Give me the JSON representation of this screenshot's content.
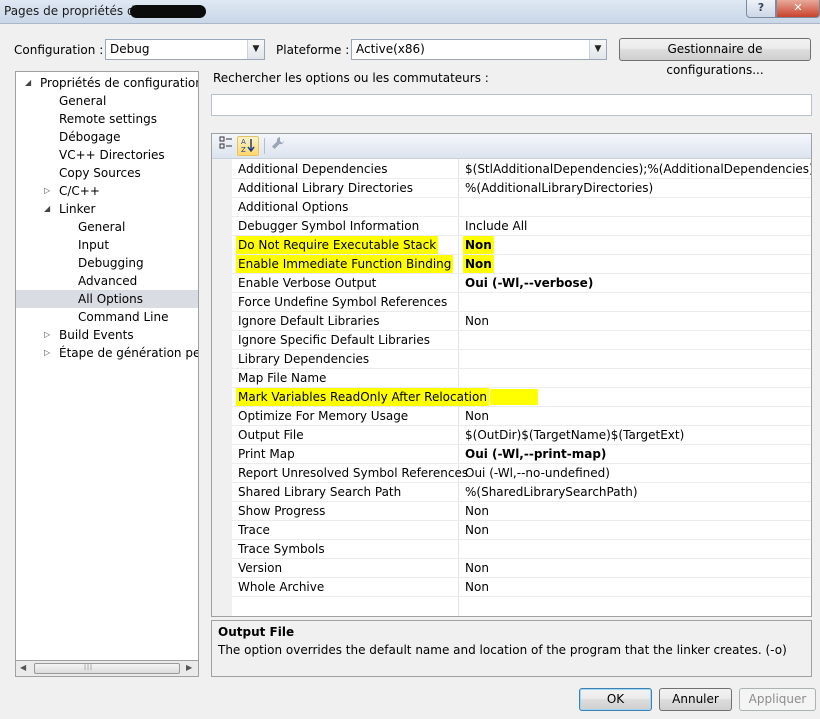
{
  "window": {
    "title": "Pages de propriétés de",
    "help_label": "?",
    "close_label": "✕"
  },
  "config": {
    "configuration_label": "Configuration :",
    "configuration_value": "Debug",
    "platform_label": "Plateforme :",
    "platform_value": "Active(x86)",
    "manager_button": "Gestionnaire de configurations..."
  },
  "tree": {
    "items": [
      {
        "label": "Propriétés de configuration",
        "expander": "◢"
      },
      {
        "label": "General"
      },
      {
        "label": "Remote settings"
      },
      {
        "label": "Débogage"
      },
      {
        "label": "VC++ Directories"
      },
      {
        "label": "Copy Sources"
      },
      {
        "label": "C/C++",
        "expander": "▷"
      },
      {
        "label": "Linker",
        "expander": "◢"
      },
      {
        "label": "General"
      },
      {
        "label": "Input"
      },
      {
        "label": "Debugging"
      },
      {
        "label": "Advanced"
      },
      {
        "label": "All Options"
      },
      {
        "label": "Command Line"
      },
      {
        "label": "Build Events",
        "expander": "▷"
      },
      {
        "label": "Étape de génération perso",
        "expander": "▷"
      }
    ],
    "selected": "All Options"
  },
  "search": {
    "label": "Rechercher les options ou les commutateurs :",
    "value": ""
  },
  "grid": {
    "rows": [
      {
        "name": "Additional Dependencies",
        "value": "$(StlAdditionalDependencies);%(AdditionalDependencies)"
      },
      {
        "name": "Additional Library Directories",
        "value": "%(AdditionalLibraryDirectories)"
      },
      {
        "name": "Additional Options",
        "value": ""
      },
      {
        "name": "Debugger Symbol Information",
        "value": "Include All"
      },
      {
        "name": "Do Not Require Executable Stack",
        "value": "Non"
      },
      {
        "name": "Enable Immediate Function Binding",
        "value": "Non"
      },
      {
        "name": "Enable Verbose Output",
        "value": "Oui (-Wl,--verbose)"
      },
      {
        "name": "Force Undefine Symbol References",
        "value": ""
      },
      {
        "name": "Ignore Default Libraries",
        "value": "Non"
      },
      {
        "name": "Ignore Specific Default Libraries",
        "value": ""
      },
      {
        "name": "Library Dependencies",
        "value": ""
      },
      {
        "name": "Map File Name",
        "value": ""
      },
      {
        "name": "Mark Variables ReadOnly After Relocation",
        "value": ""
      },
      {
        "name": "Optimize For Memory Usage",
        "value": "Non"
      },
      {
        "name": "Output File",
        "value": "$(OutDir)$(TargetName)$(TargetExt)"
      },
      {
        "name": "Print Map",
        "value": "Oui (-Wl,--print-map)"
      },
      {
        "name": "Report Unresolved Symbol References",
        "value": "Oui (-Wl,--no-undefined)"
      },
      {
        "name": "Shared Library Search Path",
        "value": "%(SharedLibrarySearchPath)"
      },
      {
        "name": "Show Progress",
        "value": "Non"
      },
      {
        "name": "Trace",
        "value": "Non"
      },
      {
        "name": "Trace Symbols",
        "value": ""
      },
      {
        "name": "Version",
        "value": "Non"
      },
      {
        "name": "Whole Archive",
        "value": "Non"
      }
    ],
    "toolbar": {
      "categorized_icon": "categorized-view-icon",
      "alphabetical_icon": "alphabetical-sort-icon",
      "property_pages_icon": "wrench-icon"
    },
    "highlight_color": "#ffff00"
  },
  "description": {
    "title": "Output File",
    "text": "The option overrides the default name and location of the program that the linker creates. (-o)"
  },
  "buttons": {
    "ok": "OK",
    "cancel": "Annuler",
    "apply": "Appliquer"
  }
}
